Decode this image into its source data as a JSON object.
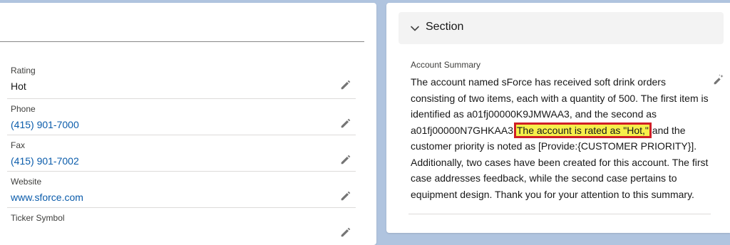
{
  "left": {
    "fields": [
      {
        "label": "Rating",
        "value": "Hot",
        "is_link": false
      },
      {
        "label": "Phone",
        "value": "(415) 901-7000",
        "is_link": true
      },
      {
        "label": "Fax",
        "value": "(415) 901-7002",
        "is_link": true
      },
      {
        "label": "Website",
        "value": "www.sforce.com",
        "is_link": true
      },
      {
        "label": "Ticker Symbol",
        "value": "",
        "is_link": false
      }
    ],
    "edit_icon": "pencil-icon"
  },
  "right": {
    "section_title": "Section",
    "section_icon": "chevron-down-icon",
    "summary_label": "Account Summary",
    "summary_before": "The account named sForce has received soft drink orders consisting of two items, each with a quantity of 500. The first item is identified as a01fj00000K9JMWAA3, and the second as a01fj00000N7GHKAA3.",
    "summary_highlight": "The account is rated as \"Hot,\"",
    "summary_after": " and the customer priority is noted as [Provide:{CUSTOMER PRIORITY}]. Additionally, two cases have been created for this account. The first case addresses feedback, while the second case pertains to equipment design. Thank you for your attention to this summary.",
    "edit_icon": "edit-sparkle-icon"
  },
  "colors": {
    "background": "#b0c4df",
    "link": "#0b5cab",
    "highlight": "#f6f04a",
    "highlight_border": "#d01f26"
  }
}
